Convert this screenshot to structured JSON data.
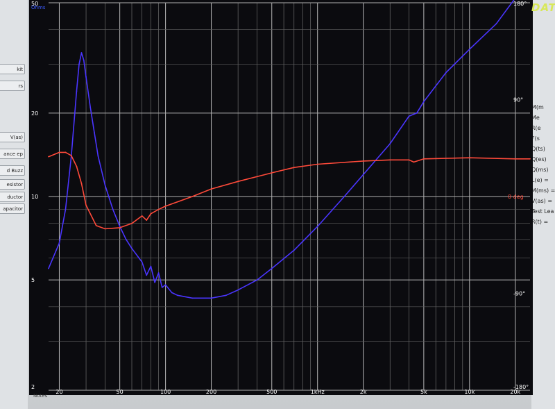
{
  "app": {
    "logo": "DATS",
    "notes_label": "Notes",
    "left_buttons": [
      "kit",
      "rs",
      "V(as)",
      "ance ep",
      "d Buzz",
      "esistor",
      "ductor",
      "apacitor"
    ],
    "right_params": [
      "M(m",
      "Me",
      "R(e",
      "F(s",
      "Q(ts)",
      "Q(es)",
      "Q(ms)",
      "L(e) =",
      "M(ms) =",
      "V(as) =",
      "Test Lea",
      "R(t) ="
    ]
  },
  "chart_data": {
    "type": "line",
    "x_scale": "log",
    "xlim": [
      17,
      25000
    ],
    "x_ticks": [
      {
        "v": 20,
        "label": "20"
      },
      {
        "v": 50,
        "label": "50"
      },
      {
        "v": 100,
        "label": "100"
      },
      {
        "v": 200,
        "label": "200"
      },
      {
        "v": 500,
        "label": "500"
      },
      {
        "v": 1000,
        "label": "1kHz"
      },
      {
        "v": 2000,
        "label": "2k"
      },
      {
        "v": 5000,
        "label": "5k"
      },
      {
        "v": 10000,
        "label": "10k"
      },
      {
        "v": 20000,
        "label": "20k"
      }
    ],
    "left_axis": {
      "label": "Ohms",
      "scale": "log",
      "ylim": [
        2,
        50
      ],
      "ticks": [
        {
          "v": 50,
          "label": "50"
        },
        {
          "v": 20,
          "label": "20"
        },
        {
          "v": 10,
          "label": "10"
        },
        {
          "v": 5,
          "label": "5"
        },
        {
          "v": 2,
          "label": "2"
        }
      ],
      "color": "#3b5bff"
    },
    "right_axis": {
      "label": "deg",
      "ylim": [
        -180,
        180
      ],
      "ticks": [
        {
          "v": 180,
          "label": "180°"
        },
        {
          "v": 90,
          "label": "90°"
        },
        {
          "v": 0,
          "label": "0 deg"
        },
        {
          "v": -90,
          "label": "-90°"
        },
        {
          "v": -180,
          "label": "-180°"
        }
      ],
      "color": "#ff4a3a"
    },
    "grid": true,
    "series": [
      {
        "axis": "left",
        "color": "#4a35ff",
        "x": [
          17,
          20,
          22,
          24,
          26,
          27,
          28,
          29,
          30,
          32,
          34,
          36,
          40,
          45,
          50,
          55,
          60,
          70,
          75,
          80,
          85,
          90,
          95,
          100,
          110,
          120,
          150,
          200,
          250,
          300,
          400,
          500,
          700,
          1000,
          1500,
          2000,
          3000,
          4000,
          4500,
          5000,
          7000,
          10000,
          15000,
          20000,
          25000
        ],
        "values": [
          5.5,
          6.8,
          9,
          14,
          24,
          30,
          33,
          31,
          27,
          21,
          17,
          14,
          11,
          9,
          7.8,
          7,
          6.5,
          5.8,
          5.2,
          5.6,
          4.9,
          5.3,
          4.7,
          4.8,
          4.5,
          4.4,
          4.3,
          4.3,
          4.4,
          4.6,
          5.0,
          5.5,
          6.4,
          7.8,
          10,
          12,
          15.5,
          19.5,
          20,
          22,
          28,
          34,
          42,
          52,
          57
        ]
      },
      {
        "axis": "right",
        "color": "#ff4a3a",
        "x": [
          17,
          20,
          22,
          24,
          26,
          28,
          30,
          35,
          40,
          50,
          60,
          70,
          75,
          80,
          90,
          100,
          150,
          200,
          300,
          500,
          700,
          1000,
          2000,
          3000,
          4000,
          4300,
          5000,
          10000,
          20000,
          25000
        ],
        "values": [
          37,
          41,
          41,
          38,
          28,
          12,
          -8,
          -27,
          -30,
          -29,
          -25,
          -18,
          -22,
          -16,
          -12,
          -9,
          0,
          7,
          14,
          22,
          27,
          30,
          33,
          34,
          34,
          32,
          35,
          36,
          35,
          35
        ]
      }
    ]
  }
}
